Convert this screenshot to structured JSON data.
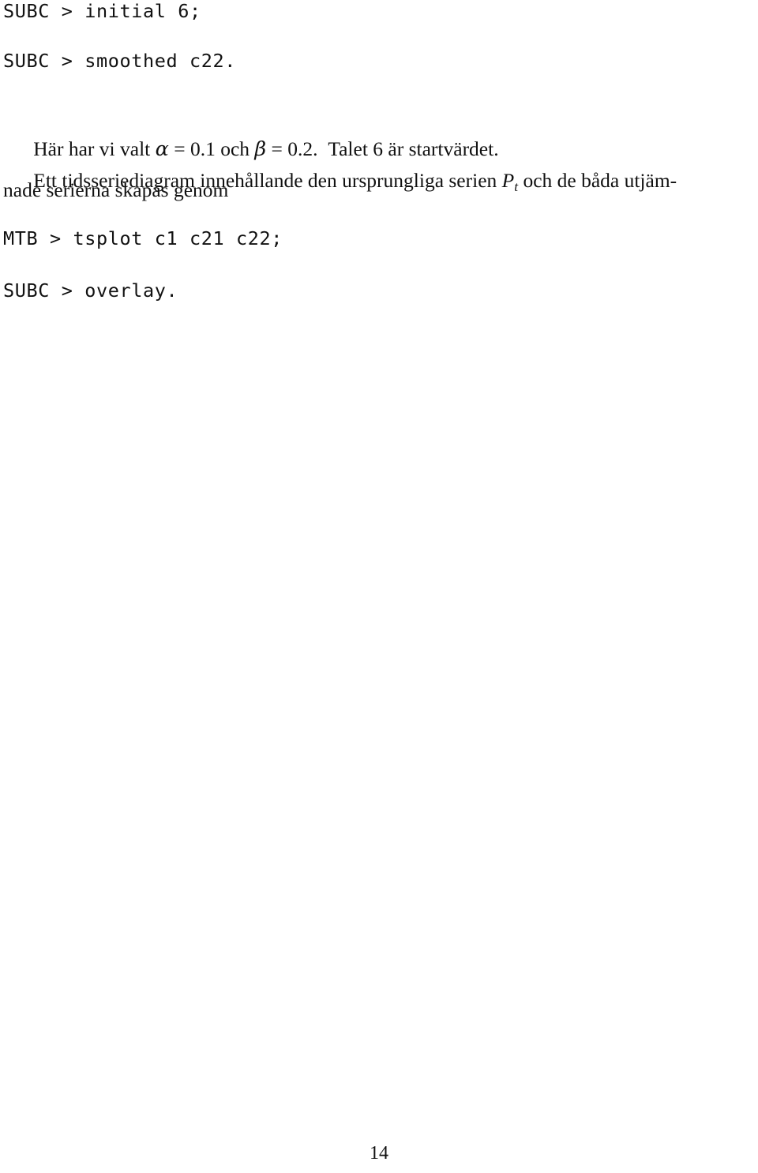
{
  "page": {
    "folio": "14",
    "language": "sv",
    "background_color": "#ffffff",
    "text_color": "#111111"
  },
  "lines": {
    "cmd_initial": "SUBC > initial 6;",
    "cmd_smoothed": "SUBC > smoothed c22.",
    "cmd_tsplot": "MTB > tsplot c1 c21 c22;",
    "cmd_overlay": "SUBC > overlay."
  },
  "paragraph1": {
    "seg_1": "Här har vi valt ",
    "alpha": "α",
    "seg_2": " = 0.1 och ",
    "beta": "β",
    "seg_3": " = 0.2.",
    "seg_4": "  Talet 6 är startvärdet."
  },
  "paragraph2": {
    "line1_seg1": "Ett tidsseriediagram innehållande den ursprungliga serien ",
    "line1_var": "P",
    "line1_var_sub": "t",
    "line1_seg2": " och de båda utjäm-",
    "line2": "nade serierna skapas genom"
  }
}
